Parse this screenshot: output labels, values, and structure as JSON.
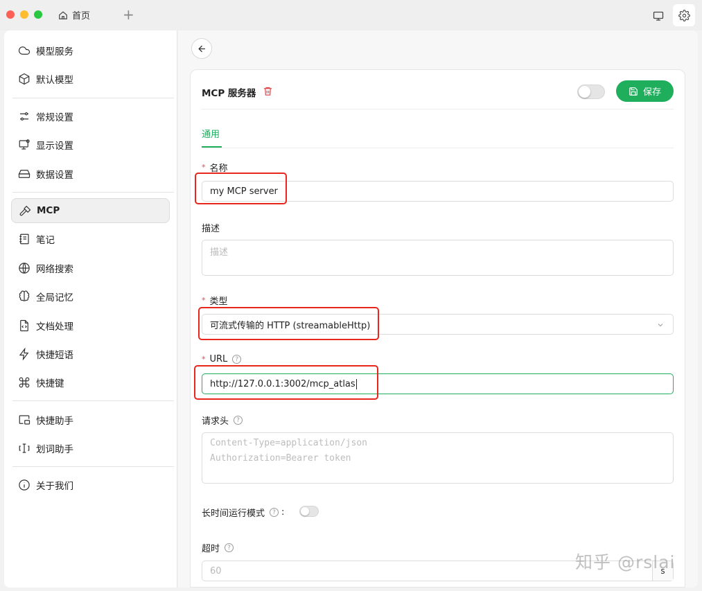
{
  "window": {
    "tab_home_label": "首页",
    "tab_add_label": "+"
  },
  "sidebar": {
    "items": [
      {
        "label": "模型服务",
        "icon": "cloud-icon"
      },
      {
        "label": "默认模型",
        "icon": "cube-icon"
      },
      {
        "label": "常规设置",
        "icon": "sliders-icon"
      },
      {
        "label": "显示设置",
        "icon": "display-icon"
      },
      {
        "label": "数据设置",
        "icon": "hard-drive-icon"
      },
      {
        "label": "MCP",
        "icon": "hammer-icon",
        "active": true
      },
      {
        "label": "笔记",
        "icon": "notebook-icon"
      },
      {
        "label": "网络搜索",
        "icon": "globe-icon"
      },
      {
        "label": "全局记忆",
        "icon": "brain-icon"
      },
      {
        "label": "文档处理",
        "icon": "file-code-icon"
      },
      {
        "label": "快捷短语",
        "icon": "zap-icon"
      },
      {
        "label": "快捷键",
        "icon": "command-icon"
      },
      {
        "label": "快捷助手",
        "icon": "picture-in-picture-icon"
      },
      {
        "label": "划词助手",
        "icon": "text-select-icon"
      },
      {
        "label": "关于我们",
        "icon": "info-icon"
      }
    ]
  },
  "card": {
    "title": "MCP 服务器",
    "enabled": false,
    "save_label": "保存",
    "tab_general": "通用"
  },
  "form": {
    "name": {
      "label": "名称",
      "required": true,
      "value": "my MCP server"
    },
    "description": {
      "label": "描述",
      "placeholder": "描述"
    },
    "type": {
      "label": "类型",
      "required": true,
      "value": "可流式传输的 HTTP (streamableHttp)"
    },
    "url": {
      "label": "URL",
      "required": true,
      "value": "http://127.0.0.1:3002/mcp_atlas"
    },
    "headers": {
      "label": "请求头",
      "placeholder_line1": "Content-Type=application/json",
      "placeholder_line2": "Authorization=Bearer token"
    },
    "long_running": {
      "label": "长时间运行模式",
      "colon": ":",
      "enabled": false
    },
    "timeout": {
      "label": "超时",
      "placeholder": "60",
      "suffix": "s"
    }
  },
  "watermark": "知乎 @rslai",
  "colors": {
    "accent": "#1fae5b",
    "annotation": "#e8261c",
    "required": "#e5484d"
  }
}
